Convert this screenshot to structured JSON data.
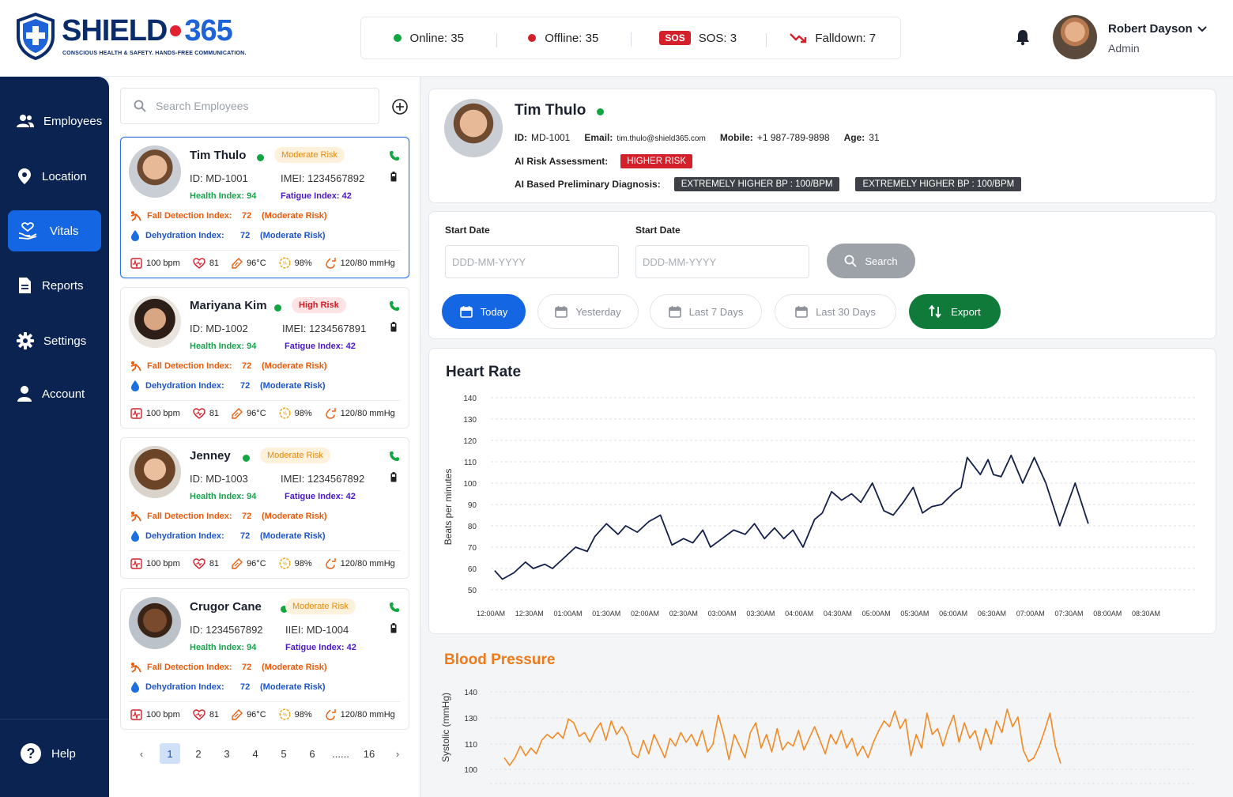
{
  "brand": {
    "name_part1": "SHIELD",
    "name_part2": "365",
    "tagline": "CONSCIOUS HEALTH & SAFETY. HANDS-FREE COMMUNICATION."
  },
  "status": {
    "online": "Online: 35",
    "offline": "Offline: 35",
    "sos_badge": "SOS",
    "sos": "SOS: 3",
    "falldown": "Falldown: 7"
  },
  "user": {
    "name": "Robert Dayson",
    "role": "Admin"
  },
  "sidebar": {
    "items": [
      {
        "label": "Employees",
        "icon": "users-icon"
      },
      {
        "label": "Location",
        "icon": "location-pin-icon"
      },
      {
        "label": "Vitals",
        "icon": "heart-hand-icon"
      },
      {
        "label": "Reports",
        "icon": "document-icon"
      },
      {
        "label": "Settings",
        "icon": "gear-icon"
      },
      {
        "label": "Account",
        "icon": "person-icon"
      }
    ],
    "active": "Vitals",
    "help": "Help"
  },
  "search": {
    "placeholder": "Search Employees"
  },
  "employees": [
    {
      "name": "Tim Thulo",
      "risk": "Moderate Risk",
      "id_label": "ID: MD-1001",
      "imei_label": "IMEI: 1234567892",
      "health": "Health Index: 94",
      "fatigue": "Fatigue Index: 42",
      "fall_label": "Fall Detection Index:",
      "fall_value": "72",
      "fall_risk": "(Moderate Risk)",
      "dehyd_label": "Dehydration Index:",
      "dehyd_value": "72",
      "dehyd_risk": "(Moderate Risk)",
      "bpm": "100 bpm",
      "hr": "81",
      "temp": "96°C",
      "spo2": "98%",
      "bp": "120/80 mmHg"
    },
    {
      "name": "Mariyana Kim",
      "risk": "High Risk",
      "id_label": "ID: MD-1002",
      "imei_label": "IMEI: 1234567891",
      "health": "Health Index: 94",
      "fatigue": "Fatigue Index: 42",
      "fall_label": "Fall Detection Index:",
      "fall_value": "72",
      "fall_risk": "(Moderate Risk)",
      "dehyd_label": "Dehydration Index:",
      "dehyd_value": "72",
      "dehyd_risk": "(Moderate Risk)",
      "bpm": "100 bpm",
      "hr": "81",
      "temp": "96°C",
      "spo2": "98%",
      "bp": "120/80 mmHg"
    },
    {
      "name": "Jenney",
      "risk": "Moderate Risk",
      "id_label": "ID: MD-1003",
      "imei_label": "IMEI: 1234567892",
      "health": "Health Index: 94",
      "fatigue": "Fatigue Index: 42",
      "fall_label": "Fall Detection Index:",
      "fall_value": "72",
      "fall_risk": "(Moderate Risk)",
      "dehyd_label": "Dehydration Index:",
      "dehyd_value": "72",
      "dehyd_risk": "(Moderate Risk)",
      "bpm": "100 bpm",
      "hr": "81",
      "temp": "96°C",
      "spo2": "98%",
      "bp": "120/80 mmHg"
    },
    {
      "name": "Crugor Cane",
      "risk": "Moderate Risk",
      "id_label": "ID: 1234567892",
      "imei_label": "IIEI: MD-1004",
      "health": "Health Index: 94",
      "fatigue": "Fatigue Index: 42",
      "fall_label": "Fall Detection Index:",
      "fall_value": "72",
      "fall_risk": "(Moderate Risk)",
      "dehyd_label": "Dehydration Index:",
      "dehyd_value": "72",
      "dehyd_risk": "(Moderate Risk)",
      "bpm": "100 bpm",
      "hr": "81",
      "temp": "96°C",
      "spo2": "98%",
      "bp": "120/80 mmHg"
    }
  ],
  "pagination": {
    "pages": [
      "1",
      "2",
      "3",
      "4",
      "5",
      "6",
      "......",
      "16"
    ],
    "current": "1"
  },
  "profile": {
    "name": "Tim Thulo",
    "id_label": "ID:",
    "id": "MD-1001",
    "email_label": "Email:",
    "email": "tim.thulo@shield365.com",
    "mobile_label": "Mobile:",
    "mobile": "+1 987-789-9898",
    "age_label": "Age:",
    "age": "31",
    "risk_label": "AI Risk Assessment:",
    "risk": "HIGHER RISK",
    "diag_label": "AI Based Preliminary Diagnosis:",
    "diagnoses": [
      "EXTREMELY HIGHER BP : 100/BPM",
      "EXTREMELY HIGHER BP : 100/BPM"
    ]
  },
  "filters": {
    "start_label_1": "Start Date",
    "start_label_2": "Start Date",
    "date_placeholder": "DDD-MM-YYYY",
    "search": "Search",
    "ranges": [
      "Today",
      "Yesterday",
      "Last 7 Days",
      "Last 30 Days"
    ],
    "active_range": "Today",
    "export": "Export"
  },
  "colors": {
    "primary": "#1566e2",
    "sidebar": "#0b2350",
    "export": "#0f7a3a",
    "danger": "#d3202b",
    "heart_line": "#13204a",
    "bp_line": "#f28a24"
  },
  "chart_data": [
    {
      "type": "line",
      "title": "Heart Rate",
      "ylabel": "Beats per minutes",
      "xlabel": "",
      "ylim": [
        50,
        140
      ],
      "yticks": [
        50,
        60,
        70,
        80,
        90,
        100,
        110,
        120,
        130,
        140
      ],
      "xticks": [
        "12:00AM",
        "12:30AM",
        "01:00AM",
        "01:30AM",
        "02:00AM",
        "02:30AM",
        "03:00AM",
        "03:30AM",
        "04:00AM",
        "04:30AM",
        "05:00AM",
        "05:30AM",
        "06:00AM",
        "06:30AM",
        "07:00AM",
        "07:30AM",
        "08:00AM",
        "08:30AM"
      ],
      "grid": true,
      "series": [
        {
          "x_hours": [
            0.05,
            0.15,
            0.3,
            0.45,
            0.55,
            0.7,
            0.8,
            0.95,
            1.1,
            1.25,
            1.35,
            1.5,
            1.65,
            1.75,
            1.9,
            2.05,
            2.2,
            2.35,
            2.5,
            2.62,
            2.75,
            2.85,
            3.0,
            3.15,
            3.3,
            3.42,
            3.55,
            3.68,
            3.8,
            3.92,
            4.05,
            4.2,
            4.3,
            4.42,
            4.55,
            4.68,
            4.8,
            4.95,
            5.1,
            5.22,
            5.35,
            5.48,
            5.6,
            5.72,
            5.85,
            6.02,
            6.1,
            6.18,
            6.35,
            6.45,
            6.52,
            6.62,
            6.75,
            6.9,
            7.05,
            7.2,
            7.38,
            7.58,
            7.75
          ],
          "y": [
            59,
            55,
            58,
            63,
            60,
            62,
            60,
            65,
            70,
            68,
            75,
            81,
            76,
            80,
            77,
            82,
            85,
            71,
            74,
            72,
            78,
            70,
            74,
            78,
            76,
            81,
            74,
            79,
            74,
            78,
            70,
            83,
            86,
            96,
            92,
            95,
            91,
            100,
            87,
            85,
            91,
            98,
            86,
            89,
            90,
            96,
            98,
            112,
            104,
            111,
            104,
            103,
            113,
            100,
            112,
            100,
            80,
            100,
            81
          ]
        }
      ]
    },
    {
      "type": "line",
      "title": "Blood Pressure",
      "ylabel": "Systolic (mmHg)",
      "xlabel": "",
      "ylim": [
        100,
        140
      ],
      "yticks": [
        100,
        110,
        130,
        140
      ],
      "grid": true,
      "series": [
        {
          "y": [
            106,
            102,
            106,
            112,
            107,
            111,
            108,
            115,
            118,
            116,
            119,
            116,
            126,
            124,
            117,
            119,
            114,
            120,
            124,
            115,
            125,
            118,
            122,
            117,
            108,
            106,
            115,
            108,
            118,
            112,
            106,
            116,
            112,
            119,
            114,
            118,
            112,
            120,
            109,
            113,
            128,
            118,
            105,
            118,
            112,
            106,
            119,
            124,
            111,
            118,
            109,
            121,
            110,
            114,
            112,
            120,
            110,
            116,
            122,
            115,
            108,
            118,
            113,
            120,
            111,
            116,
            107,
            112,
            106,
            114,
            120,
            125,
            122,
            130,
            121,
            126,
            107,
            118,
            111,
            129,
            118,
            121,
            112,
            121,
            128,
            114,
            124,
            116,
            120,
            110,
            121,
            113,
            125,
            119,
            131,
            122,
            127,
            110,
            104,
            106,
            112,
            120,
            129,
            112,
            103
          ]
        }
      ]
    }
  ]
}
